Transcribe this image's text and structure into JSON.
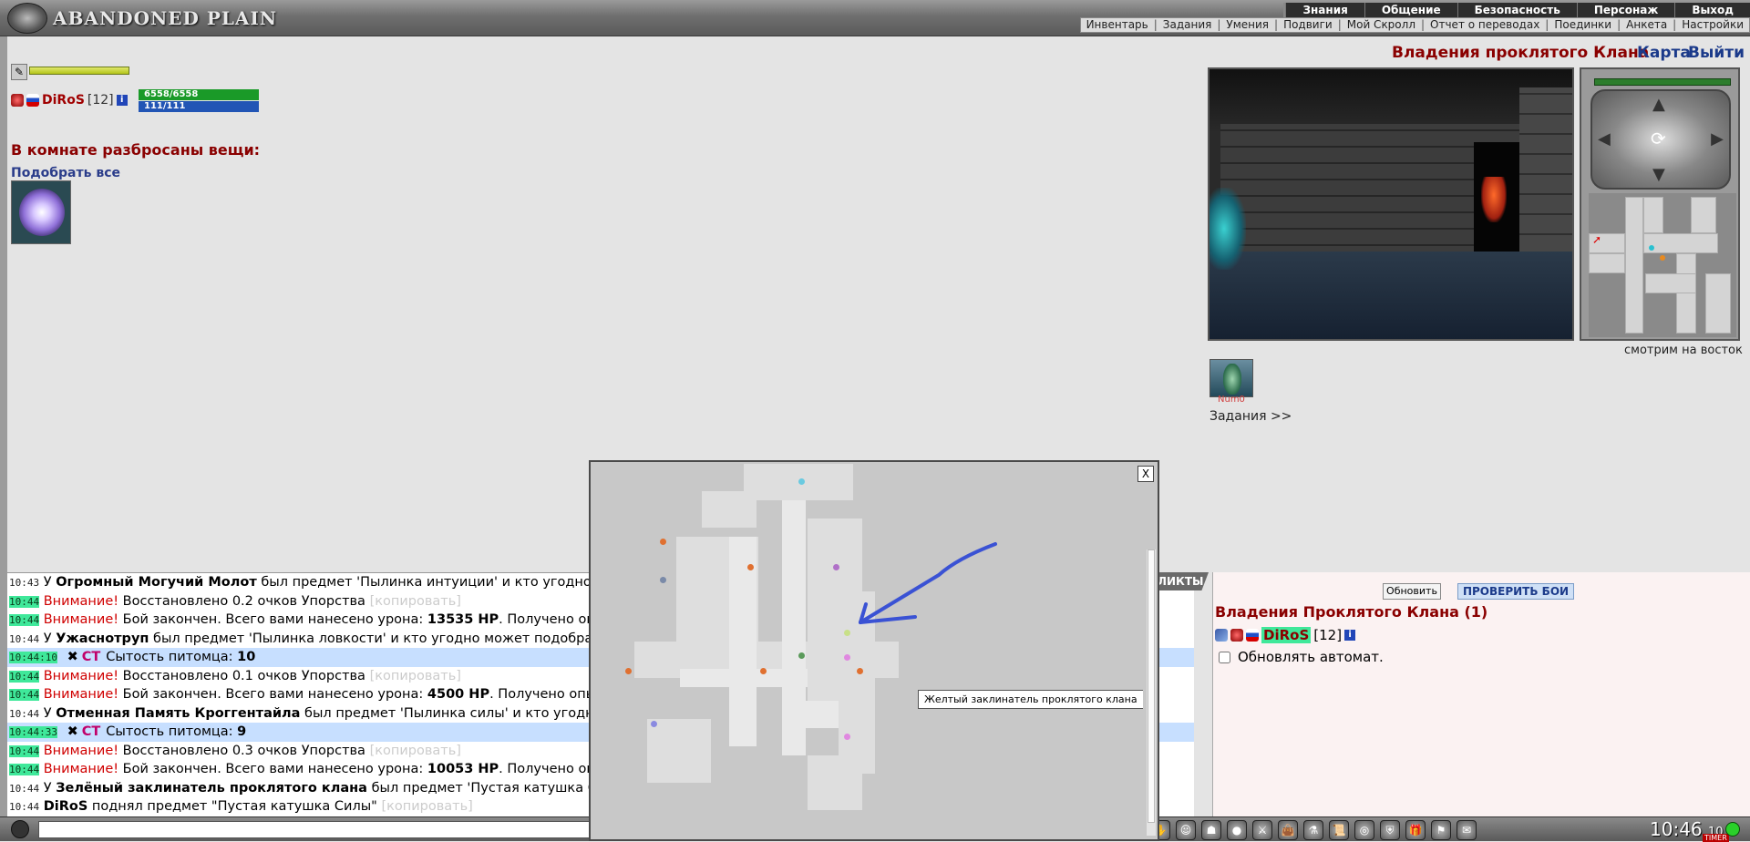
{
  "app": {
    "logo_text": "ABANDONED PLAIN"
  },
  "menu_top": [
    "Знания",
    "Общение",
    "Безопасность",
    "Персонаж",
    "Выход"
  ],
  "menu_sub": [
    "Инвентарь",
    "Задания",
    "Умения",
    "Подвиги",
    "Мой Скролл",
    "Отчет о переводах",
    "Поединки",
    "Анкета",
    "Настройки"
  ],
  "player": {
    "name": "DiRoS",
    "level": "[12]",
    "hp": "6558/6558",
    "mp": "111/111",
    "info": "i"
  },
  "room": {
    "title": "В комнате разбросаны вещи:",
    "pickup_all": "Подобрать все"
  },
  "location": {
    "title": "Владения проклятого Клана",
    "map_link": "Карта",
    "exit_link": "Выйти",
    "facing": "смотрим на восток"
  },
  "pet": {
    "name": "Num0"
  },
  "quests_link": "Задания >>",
  "chat_tab": "ЛИКТЫ",
  "chat": [
    {
      "ts": "10:43",
      "tsclass": "",
      "parts": [
        [
          "",
          "У "
        ],
        [
          "bold",
          "Огромный Могучий Молот"
        ],
        [
          "",
          " был предмет 'Пылинка интуиции' и кто угодно может подобрать"
        ]
      ],
      "hl": false
    },
    {
      "ts": "10:44",
      "tsclass": "green",
      "parts": [
        [
          "warn",
          "Внимание!"
        ],
        [
          "",
          " Восстановлено 0.2 очков Упорства "
        ],
        [
          "copy",
          "[копировать]"
        ]
      ],
      "hl": false
    },
    {
      "ts": "10:44",
      "tsclass": "green",
      "parts": [
        [
          "warn",
          "Внимание!"
        ],
        [
          "",
          " Бой закончен. Всего вами нанесено урона: "
        ],
        [
          "bold",
          "13535 HP"
        ],
        [
          "",
          ". Получено опыта"
        ]
      ],
      "hl": false
    },
    {
      "ts": "10:44",
      "tsclass": "",
      "parts": [
        [
          "",
          "У "
        ],
        [
          "bold",
          "Ужаснотруп"
        ],
        [
          "",
          " был предмет 'Пылинка ловкости' и кто угодно может подобрать"
        ]
      ],
      "hl": false
    },
    {
      "ts": "10:44:10",
      "tsclass": "green",
      "parts": [
        [
          "x",
          "✖"
        ],
        [
          "ct",
          "СТ"
        ],
        [
          "",
          "Сытость питомца: "
        ],
        [
          "bold",
          "10"
        ]
      ],
      "hl": true
    },
    {
      "ts": "10:44",
      "tsclass": "green",
      "parts": [
        [
          "warn",
          "Внимание!"
        ],
        [
          "",
          " Восстановлено 0.1 очков Упорства "
        ],
        [
          "copy",
          "[копировать]"
        ]
      ],
      "hl": false
    },
    {
      "ts": "10:44",
      "tsclass": "green",
      "parts": [
        [
          "warn",
          "Внимание!"
        ],
        [
          "",
          " Бой закончен. Всего вами нанесено урона: "
        ],
        [
          "bold",
          "4500 HP"
        ],
        [
          "",
          ". Получено опыта"
        ]
      ],
      "hl": false
    },
    {
      "ts": "10:44",
      "tsclass": "",
      "parts": [
        [
          "",
          "У "
        ],
        [
          "bold",
          "Отменная Память Кроггентайла"
        ],
        [
          "",
          " был предмет 'Пылинка силы' и кто угодно может подобрать"
        ]
      ],
      "hl": false
    },
    {
      "ts": "10:44:33",
      "tsclass": "green",
      "parts": [
        [
          "x",
          "✖"
        ],
        [
          "ct",
          "СТ"
        ],
        [
          "",
          "Сытость питомца: "
        ],
        [
          "bold",
          "9"
        ]
      ],
      "hl": true
    },
    {
      "ts": "10:44",
      "tsclass": "green",
      "parts": [
        [
          "warn",
          "Внимание!"
        ],
        [
          "",
          " Восстановлено 0.3 очков Упорства "
        ],
        [
          "copy",
          "[копировать]"
        ]
      ],
      "hl": false
    },
    {
      "ts": "10:44",
      "tsclass": "green",
      "parts": [
        [
          "warn",
          "Внимание!"
        ],
        [
          "",
          " Бой закончен. Всего вами нанесено урона: "
        ],
        [
          "bold",
          "10053 HP"
        ],
        [
          "",
          ". Получено опыта"
        ]
      ],
      "hl": false
    },
    {
      "ts": "10:44",
      "tsclass": "",
      "parts": [
        [
          "",
          "У "
        ],
        [
          "bold",
          "Зелёный заклинатель проклятого клана"
        ],
        [
          "",
          " был предмет 'Пустая катушка Силы'"
        ]
      ],
      "hl": false
    },
    {
      "ts": "10:44",
      "tsclass": "",
      "parts": [
        [
          "bold",
          "DiRoS"
        ],
        [
          "",
          " поднял предмет \"Пустая катушка Силы\" "
        ],
        [
          "copy",
          "[копировать]"
        ]
      ],
      "hl": false
    }
  ],
  "right_panel": {
    "refresh": "Обновить",
    "check_fights": "ПРОВЕРИТЬ БОИ",
    "clan_title": "Владения Проклятого Клана (1)",
    "member_name": "DiRoS",
    "member_level": "[12]",
    "auto_update": "Обновлять автомат."
  },
  "map_modal": {
    "close": "X",
    "tooltip": "Желтый заклинатель проклятого клана"
  },
  "clock": {
    "time": "10:46",
    "seconds": "10",
    "timer_label": "TIMER"
  },
  "colors": {
    "accent_red": "#8a0000",
    "link_blue": "#1b3a8a",
    "hp_green": "#1a9a28",
    "mp_blue": "#2255b5",
    "highlight": "#c7dfff"
  },
  "bottom_icons": [
    "hand-icon",
    "face-icon",
    "mask-icon",
    "orb-icon",
    "sword-icon",
    "bag-icon",
    "potion-icon",
    "scroll-icon",
    "ring-icon",
    "shield-icon",
    "gift-icon",
    "flag-icon",
    "note-icon"
  ]
}
